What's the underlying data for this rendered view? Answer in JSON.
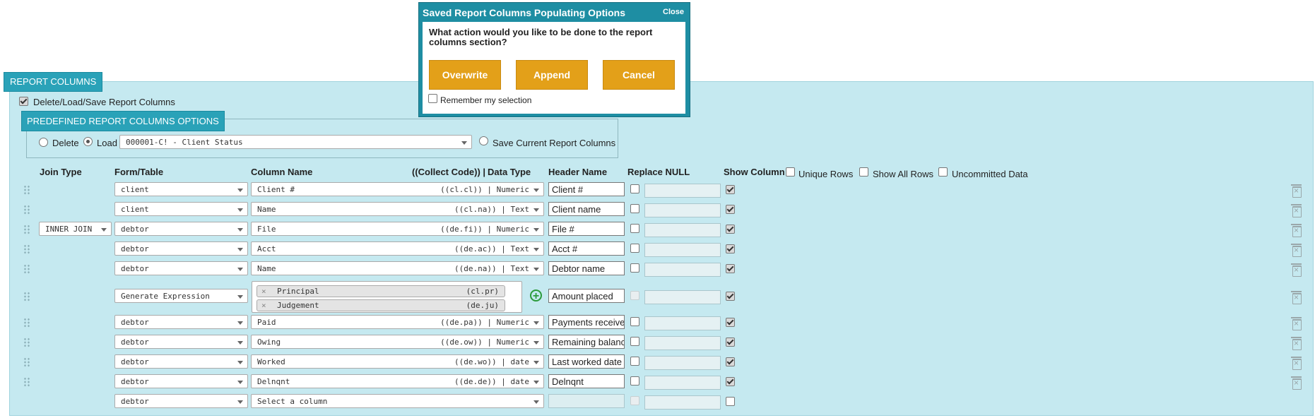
{
  "panel": {
    "title": "REPORT COLUMNS",
    "delete_load_save_label": "Delete/Load/Save Report Columns"
  },
  "predefined": {
    "title": "PREDEFINED REPORT COLUMNS OPTIONS",
    "delete_label": "Delete",
    "load_label": "Load",
    "load_value": "000001-C! - Client Status",
    "save_label": "Save Current Report Columns"
  },
  "headers": {
    "join_type": "Join Type",
    "form_table": "Form/Table",
    "column_name": "Column Name",
    "collect_code": "((Collect Code)) |",
    "data_type": "Data Type",
    "header_name": "Header Name",
    "replace_null": "Replace NULL",
    "show_column": "Show Column",
    "unique_rows": "Unique Rows",
    "show_all_rows": "Show All Rows",
    "uncommitted_data": "Uncommitted Data"
  },
  "rows": [
    {
      "join": "",
      "table": "client",
      "column": "Client #",
      "code": "((cl.cl)) | Numeric",
      "header": "Client #",
      "show": true
    },
    {
      "join": "",
      "table": "client",
      "column": "Name",
      "code": "((cl.na)) | Text",
      "header": "Client name",
      "show": true
    },
    {
      "join": "INNER JOIN",
      "table": "debtor",
      "column": "File",
      "code": "((de.fi)) | Numeric",
      "header": "File #",
      "show": true
    },
    {
      "join": "",
      "table": "debtor",
      "column": "Acct",
      "code": "((de.ac)) | Text",
      "header": "Acct #",
      "show": true
    },
    {
      "join": "",
      "table": "debtor",
      "column": "Name",
      "code": "((de.na)) | Text",
      "header": "Debtor name",
      "show": true
    },
    {
      "join": "",
      "table": "Generate Expression",
      "column": "",
      "code": "",
      "header": "Amount placed",
      "show": true
    },
    {
      "join": "",
      "table": "debtor",
      "column": "Paid",
      "code": "((de.pa)) | Numeric",
      "header": "Payments received",
      "show": true
    },
    {
      "join": "",
      "table": "debtor",
      "column": "Owing",
      "code": "((de.ow)) | Numeric",
      "header": "Remaining balance",
      "show": true
    },
    {
      "join": "",
      "table": "debtor",
      "column": "Worked",
      "code": "((de.wo)) | date",
      "header": "Last worked date",
      "show": true
    },
    {
      "join": "",
      "table": "debtor",
      "column": "Delnqnt",
      "code": "((de.de)) | date",
      "header": "Delnqnt",
      "show": true
    },
    {
      "join": "",
      "table": "debtor",
      "column": "Select a column",
      "code": "",
      "header": "",
      "show": false
    }
  ],
  "expression_chips": [
    {
      "name": "Principal",
      "code": "(cl.pr)"
    },
    {
      "name": "Judgement",
      "code": "(de.ju)"
    }
  ],
  "dialog": {
    "title": "Saved Report Columns Populating Options",
    "close_label": "Close",
    "question": "What action would you like to be done to the report columns section?",
    "overwrite_label": "Overwrite",
    "append_label": "Append",
    "cancel_label": "Cancel",
    "remember_label": "Remember my selection"
  }
}
